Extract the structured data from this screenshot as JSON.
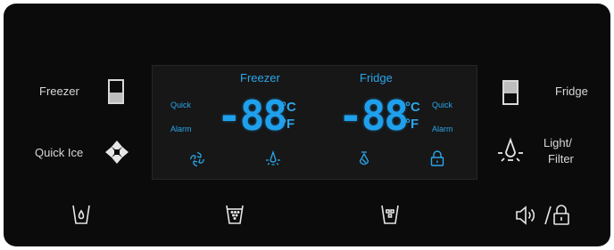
{
  "left": {
    "freezer_label": "Freezer",
    "quick_ice_label": "Quick Ice"
  },
  "right": {
    "fridge_label": "Fridge",
    "light_filter_line1": "Light/",
    "light_filter_line2": "Filter"
  },
  "display": {
    "freezer_title": "Freezer",
    "fridge_title": "Fridge",
    "freezer_temp": "-88",
    "fridge_temp": "-88",
    "unit_c": "°C",
    "unit_f": "°F",
    "quick_left": "Quick",
    "alarm_left": "Alarm",
    "quick_right": "Quick",
    "alarm_right": "Alarm"
  },
  "icons": {
    "freezer_button": "freezer-compartment-icon",
    "quick_ice_button": "quick-ice-icon",
    "fridge_button": "fridge-compartment-icon",
    "light_filter_button": "light-bulb-icon",
    "water_dispense": "water-glass-icon",
    "cubed_ice": "cubed-ice-glass-icon",
    "crushed_ice": "crushed-ice-glass-icon",
    "sound_lock": "sound-lock-icon"
  },
  "colors": {
    "panel": "#0b0b0b",
    "lcd_text": "#2aa6ea",
    "label_text": "#d8d8d8"
  }
}
